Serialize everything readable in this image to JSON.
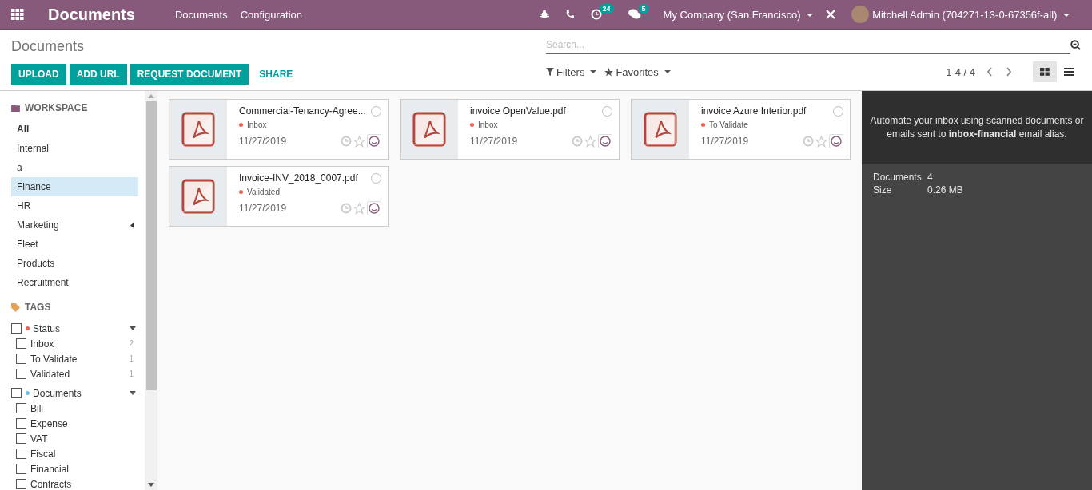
{
  "navbar": {
    "app_title": "Documents",
    "menu": [
      "Documents",
      "Configuration"
    ],
    "activity_count": "24",
    "message_count": "5",
    "company": "My Company (San Francisco)",
    "user": "Mitchell Admin (704271-13-0-67356f-all)"
  },
  "control_panel": {
    "breadcrumb": "Documents",
    "buttons": [
      "UPLOAD",
      "ADD URL",
      "REQUEST DOCUMENT"
    ],
    "link_button": "SHARE",
    "search": {
      "placeholder": "Search..."
    },
    "filters": "Filters",
    "favorites": "Favorites",
    "pager": "1-4 / 4",
    "views": [
      {
        "kind": "kanban",
        "selected": true
      },
      {
        "kind": "list",
        "selected": false
      }
    ]
  },
  "sidebar": {
    "workspace_title": "WORKSPACE",
    "workspaces": [
      {
        "label": "All",
        "selected": false,
        "bold": true,
        "has_children": false
      },
      {
        "label": "Internal",
        "selected": false,
        "bold": false,
        "has_children": false
      },
      {
        "label": "a",
        "selected": false,
        "bold": false,
        "has_children": false
      },
      {
        "label": "Finance",
        "selected": true,
        "bold": false,
        "has_children": false
      },
      {
        "label": "HR",
        "selected": false,
        "bold": false,
        "has_children": false
      },
      {
        "label": "Marketing",
        "selected": false,
        "bold": false,
        "has_children": true
      },
      {
        "label": "Fleet",
        "selected": false,
        "bold": false,
        "has_children": false
      },
      {
        "label": "Products",
        "selected": false,
        "bold": false,
        "has_children": false
      },
      {
        "label": "Recruitment",
        "selected": false,
        "bold": false,
        "has_children": false
      }
    ],
    "tags_title": "TAGS",
    "tag_groups": [
      {
        "label": "Status",
        "color": "#f06050",
        "checked": false,
        "expanded": true,
        "tags": [
          {
            "label": "Inbox",
            "checked": false,
            "count": "2"
          },
          {
            "label": "To Validate",
            "checked": false,
            "count": "1"
          },
          {
            "label": "Validated",
            "checked": false,
            "count": "1"
          }
        ]
      },
      {
        "label": "Documents",
        "color": "#6cc1ed",
        "checked": false,
        "expanded": true,
        "tags": [
          {
            "label": "Bill",
            "checked": false
          },
          {
            "label": "Expense",
            "checked": false
          },
          {
            "label": "VAT",
            "checked": false
          },
          {
            "label": "Fiscal",
            "checked": false
          },
          {
            "label": "Financial",
            "checked": false
          },
          {
            "label": "Contracts",
            "checked": false
          }
        ]
      }
    ]
  },
  "documents": [
    {
      "name": "Commercial-Tenancy-Agree...",
      "tag": {
        "label": "Inbox",
        "color": "#f06050"
      },
      "date": "11/27/2019",
      "selected": false,
      "starred": false
    },
    {
      "name": "invoice OpenValue.pdf",
      "tag": {
        "label": "Inbox",
        "color": "#f06050"
      },
      "date": "11/27/2019",
      "selected": false,
      "starred": false
    },
    {
      "name": "invoice Azure Interior.pdf",
      "tag": {
        "label": "To Validate",
        "color": "#f06050"
      },
      "date": "11/27/2019",
      "selected": false,
      "starred": false
    },
    {
      "name": "Invoice-INV_2018_0007.pdf",
      "tag": {
        "label": "Validated",
        "color": "#f06050"
      },
      "date": "11/27/2019",
      "selected": false,
      "starred": false
    }
  ],
  "inspector": {
    "message": "Automate your inbox using scanned documents or emails sent to **inbox-financial** email alias.",
    "stats": [
      {
        "label": "Documents",
        "value": "4"
      },
      {
        "label": "Size",
        "value": "0.26 MB"
      }
    ]
  }
}
